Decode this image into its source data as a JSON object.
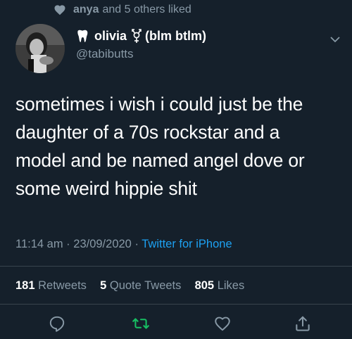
{
  "social_context": {
    "icon": "heart-icon",
    "liker": "anya",
    "rest": "and 5 others liked"
  },
  "author": {
    "avatar": "profile-photo",
    "name": "olivia",
    "symbol_after_name": "transgender-symbol",
    "name_suffix": "(blm btlm)",
    "handle": "@tabibutts",
    "badge_icon": "tooth-icon"
  },
  "tweet": {
    "lines": [
      "sometimes i wish i could just be the",
      "daughter of a 70s rockstar and a",
      "model and be named angel dove or",
      "some weird hippie shit"
    ],
    "time": "11:14 am",
    "date": "23/09/2020",
    "separator": "·",
    "source": "Twitter for iPhone"
  },
  "stats": {
    "retweets_count": "181",
    "retweets_label": "Retweets",
    "quotes_count": "5",
    "quotes_label": "Quote Tweets",
    "likes_count": "805",
    "likes_label": "Likes"
  },
  "actions": [
    {
      "icon": "reply-icon"
    },
    {
      "icon": "retweet-icon",
      "color": "#17bf63"
    },
    {
      "icon": "like-icon"
    },
    {
      "icon": "share-icon"
    }
  ],
  "colors": {
    "background": "#15202b",
    "secondary_text": "#8899a6",
    "link": "#1da1f2",
    "retweet_green": "#17bf63",
    "divider": "#38444d"
  }
}
